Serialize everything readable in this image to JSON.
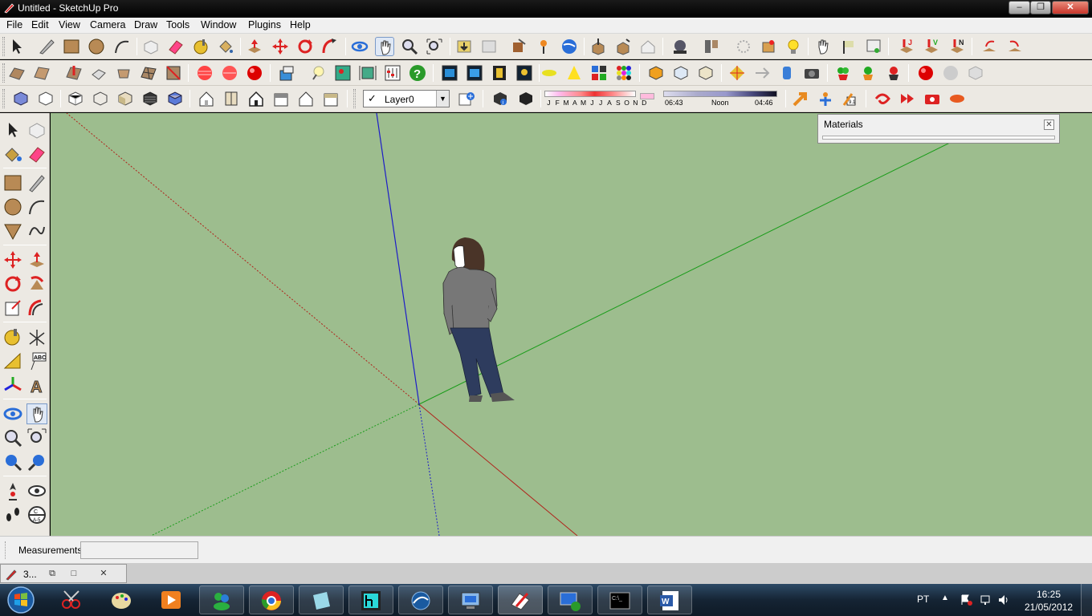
{
  "window": {
    "title": "Untitled - SketchUp Pro",
    "minimize": "‒",
    "maximize": "❐",
    "close": "✕"
  },
  "menu": [
    "File",
    "Edit",
    "View",
    "Camera",
    "Draw",
    "Tools",
    "Window",
    "Plugins",
    "Help"
  ],
  "layer": {
    "check": "✓",
    "value": "Layer0"
  },
  "shadows": {
    "months": [
      "J",
      "F",
      "M",
      "A",
      "M",
      "J",
      "J",
      "A",
      "S",
      "O",
      "N",
      "D"
    ],
    "time_start": "06:43",
    "time_mid": "Noon",
    "time_end": "04:46"
  },
  "materials_panel": {
    "title": "Materials",
    "close": "✕"
  },
  "status": {
    "measurements_label": "Measurements",
    "measurements_value": ""
  },
  "minimized_doc": {
    "title": "3...",
    "restore": "⧉",
    "maximize": "□",
    "close": "✕"
  },
  "taskbar": {
    "apps": [
      "snipping-tool",
      "paint-program",
      "media-player",
      "messenger",
      "chrome",
      "notepad-app",
      "fractal-app",
      "network-app",
      "remote-desktop",
      "sketchup",
      "vpn-client",
      "command-prompt",
      "word"
    ],
    "language": "PT",
    "tray_up": "▲",
    "time": "16:25",
    "date": "21/05/2012"
  },
  "colors": {
    "viewport": "#9dbd8e",
    "axis_red": "#b0241c",
    "axis_green": "#1a9c1a",
    "axis_blue": "#1d1dc8"
  }
}
